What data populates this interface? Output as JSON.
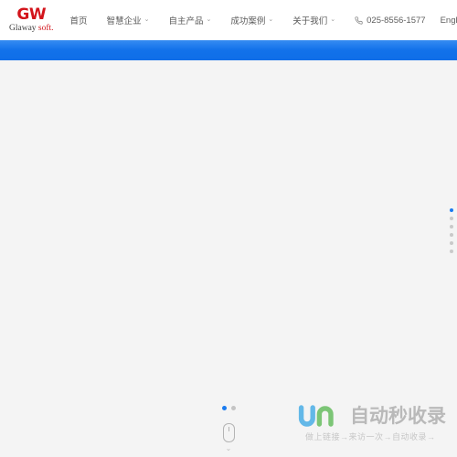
{
  "header": {
    "logo": {
      "mark": "GW",
      "word_dark": "Glaway ",
      "word_red": "soft."
    },
    "nav": [
      {
        "label": "首页",
        "has_dropdown": false,
        "caret": ""
      },
      {
        "label": "智慧企业",
        "has_dropdown": true,
        "caret": "⌄"
      },
      {
        "label": "自主产品",
        "has_dropdown": true,
        "caret": "⌄"
      },
      {
        "label": "成功案例",
        "has_dropdown": true,
        "caret": "⌄"
      },
      {
        "label": "关于我们",
        "has_dropdown": true,
        "caret": "⌄"
      }
    ],
    "phone": {
      "icon": "phone-icon",
      "number": "025-8556-1577"
    },
    "language": "English"
  },
  "banner": {
    "color": "#1272ea"
  },
  "hero": {
    "background_color": "#f4f4f4"
  },
  "side_pager": {
    "active_index": 0,
    "dots": [
      {
        "label": "1"
      },
      {
        "label": "2"
      },
      {
        "label": "3"
      },
      {
        "label": "4"
      },
      {
        "label": "5"
      },
      {
        "label": "6"
      }
    ]
  },
  "slider_dots": {
    "active_index": 0,
    "dots": [
      {
        "label": "1"
      },
      {
        "label": "2"
      }
    ]
  },
  "scroll_indicator": {
    "icon": "mouse-scroll-icon",
    "chevron": "⌄"
  },
  "watermark": {
    "logo_icon": "jn-logo-icon",
    "title": "自动秒收录",
    "subtitle": "做上链接→来访一次→自动收录→"
  },
  "colors": {
    "brand_red": "#d3141b",
    "accent_blue": "#1272ea",
    "page_bg": "#f4f4f4",
    "header_bg": "#ffffff",
    "nav_text": "#5a5a5a",
    "dot_inactive": "#c9c9c9",
    "watermark_gray": "#b9b9b9"
  }
}
